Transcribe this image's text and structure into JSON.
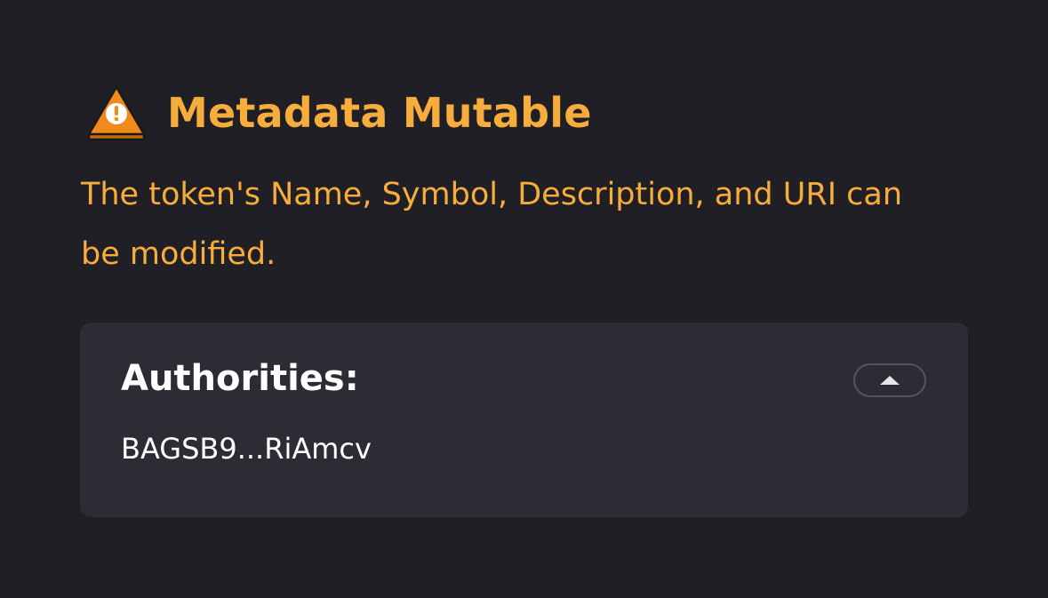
{
  "warning": {
    "icon": "warning-triangle-icon",
    "title": "Metadata Mutable",
    "description": "The token's Name, Symbol, Description, and URI can be modified.",
    "accent_color": "#f6ad3c"
  },
  "authorities": {
    "label": "Authorities:",
    "toggle_icon": "chevron-up-icon",
    "items": [
      "BAGSB9...RiAmcv"
    ]
  }
}
